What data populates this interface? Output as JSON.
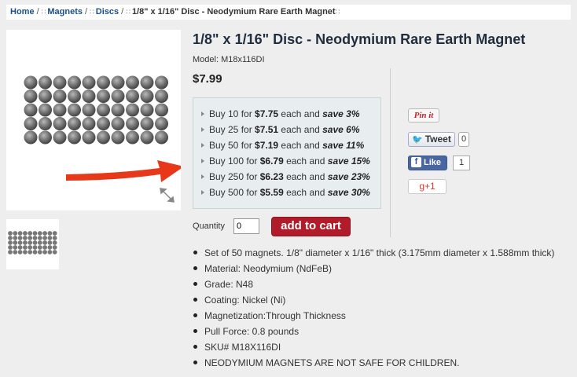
{
  "breadcrumb": {
    "home": "Home",
    "separator": "/",
    "grip": "∷",
    "magnets": "Magnets",
    "discs": "Discs",
    "current": "1/8\" x 1/16\" Disc - Neodymium Rare Earth Magnet"
  },
  "product": {
    "title": "1/8\" x 1/16\" Disc - Neodymium Rare Earth Magnet",
    "model": "Model: M18x116DI",
    "price": "$7.99"
  },
  "discounts": [
    {
      "pre": "Buy 10 for ",
      "price": "$7.75",
      "mid": " each and ",
      "save": "save 3%"
    },
    {
      "pre": "Buy 25 for ",
      "price": "$7.51",
      "mid": " each and ",
      "save": "save 6%"
    },
    {
      "pre": "Buy 50 for ",
      "price": "$7.19",
      "mid": " each and ",
      "save": "save 11%"
    },
    {
      "pre": "Buy 100 for ",
      "price": "$6.79",
      "mid": " each and ",
      "save": "save 15%"
    },
    {
      "pre": "Buy 250 for ",
      "price": "$6.23",
      "mid": " each and ",
      "save": "save 23%"
    },
    {
      "pre": "Buy 500 for ",
      "price": "$5.59",
      "mid": " each and ",
      "save": "save 30%"
    }
  ],
  "cart": {
    "quantity_label": "Quantity",
    "quantity_value": "0",
    "add_label": "add to cart"
  },
  "features": [
    "Set of 50 magnets. 1/8\" diameter x 1/16\" thick (3.175mm diameter x 1.588mm thick)",
    "Material: Neodymium (NdFeB)",
    "Grade: N48",
    "Coating: Nickel (Ni)",
    "Magnetization:Through Thickness",
    "Pull Force: 0.8 pounds",
    "SKU# M18X116DI",
    "NEODYMIUM MAGNETS ARE NOT SAFE FOR CHILDREN."
  ],
  "social": {
    "pinit": "Pin it",
    "tweet": "Tweet",
    "tweet_count": "0",
    "fb_like": "Like",
    "fb_count": "1",
    "gplus": "g+1"
  },
  "colors": {
    "link": "#1a4f8a",
    "cart_button": "#b01c2a",
    "arrow": "#e8381a",
    "discount_bg": "#e8eef0"
  },
  "icons": [
    "bullet-triangle-icon",
    "expand-icon",
    "twitter-bird-icon",
    "facebook-f-icon"
  ]
}
